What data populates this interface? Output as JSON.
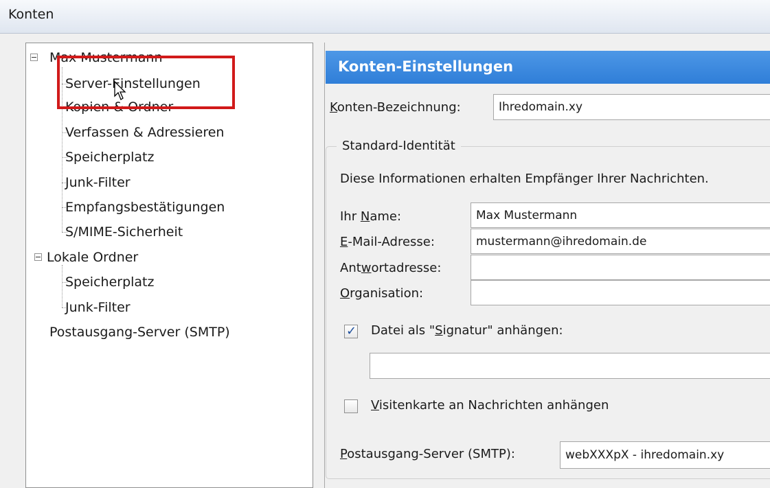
{
  "window": {
    "title": "Konten"
  },
  "tree": {
    "account": {
      "label": "Max Mustermann",
      "children": [
        "Server-Einstellungen",
        "Kopien & Ordner",
        "Verfassen & Adressieren",
        "Speicherplatz",
        "Junk-Filter",
        "Empfangsbestätigungen",
        "S/MIME-Sicherheit"
      ]
    },
    "local": {
      "label": "Lokale Ordner",
      "children": [
        "Speicherplatz",
        "Junk-Filter"
      ]
    },
    "smtp": "Postausgang-Server (SMTP)"
  },
  "panel": {
    "header": "Konten-Einstellungen",
    "account_name_label_prefix": "K",
    "account_name_label_rest": "onten-Bezeichnung:",
    "account_name_value": "Ihredomain.xy",
    "identity": {
      "legend": "Standard-Identität",
      "info": "Diese Informationen erhalten Empfänger Ihrer Nachrichten.",
      "name_pre": "Ihr ",
      "name_u": "N",
      "name_post": "ame:",
      "name_value": "Max Mustermann",
      "email_u": "E",
      "email_post": "-Mail-Adresse:",
      "email_value": "mustermann@ihredomain.de",
      "reply_pre": "Ant",
      "reply_u": "w",
      "reply_post": "ortadresse:",
      "reply_value": "",
      "org_u": "O",
      "org_post": "rganisation:",
      "org_value": "",
      "sig_pre": "Datei als \"",
      "sig_u": "S",
      "sig_post": "ignatur\" anhängen:",
      "sig_checked": true,
      "sig_value": "",
      "vcard_u": "V",
      "vcard_post": "isitenkarte an Nachrichten anhängen",
      "vcard_checked": false,
      "smtp_u": "P",
      "smtp_post": "ostausgang-Server (SMTP):",
      "smtp_value": "webXXXpX  - ihredomain.xy"
    }
  }
}
